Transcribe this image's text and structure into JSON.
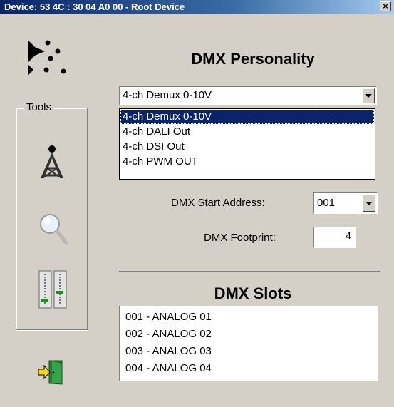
{
  "window": {
    "title": "Device: 53 4C : 30 04 A0 00 - Root Device",
    "close_glyph": "×"
  },
  "sidebar": {
    "tools_label": "Tools",
    "tools": [
      {
        "icon": "antenna-tower-icon"
      },
      {
        "icon": "magnifier-icon"
      },
      {
        "icon": "faders-icon"
      }
    ],
    "exit_icon": "exit-door-icon"
  },
  "personality": {
    "heading": "DMX Personality",
    "selected": "4-ch Demux 0-10V",
    "options": [
      "4-ch Demux 0-10V",
      "4-ch DALI Out",
      "4-ch DSI  Out",
      "4-ch PWM OUT"
    ],
    "selected_index": 0
  },
  "start_address": {
    "label": "DMX Start Address:",
    "value": "001"
  },
  "footprint": {
    "label": "DMX Footprint:",
    "value": "4"
  },
  "slots": {
    "heading": "DMX Slots",
    "items": [
      "001 - ANALOG 01",
      "002 - ANALOG 02",
      "003 - ANALOG 03",
      "004 - ANALOG 04"
    ]
  },
  "colors": {
    "titlebar_start": "#0a246a",
    "titlebar_end": "#a6caf0",
    "selection": "#0a246a",
    "fader_led": "#00a000",
    "exit_green": "#2ea84a"
  }
}
